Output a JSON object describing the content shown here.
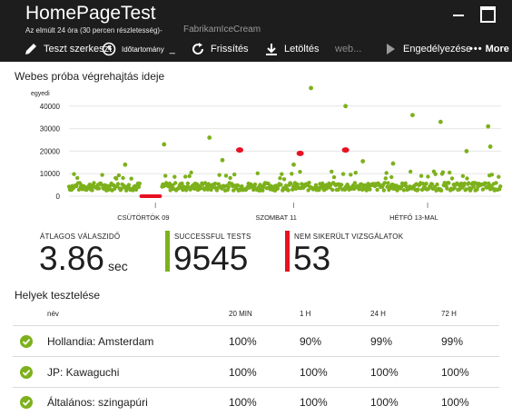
{
  "header": {
    "title": "HomePageTest",
    "subtitle": "Az elmúlt 24 óra (30 percen részletesség)-",
    "resource": "FabrikamIceCream"
  },
  "toolbar": {
    "edit_label": "Teszt szerkeszt",
    "timerange_label": "Időtartomány",
    "timerange_suffix": "_",
    "refresh_label": "Frissítés",
    "download_label": "Letöltés",
    "web_label": "web...",
    "enable_label": "Engedélyezése",
    "more_label": "More"
  },
  "chart": {
    "title": "Webes próba végrehajtás ideje",
    "unit_label": "egyedi"
  },
  "chart_data": {
    "type": "scatter",
    "title": "Webes próba végrehajtás ideje",
    "ylabel": "egyedi",
    "yticks": [
      0,
      10000,
      20000,
      30000,
      40000
    ],
    "ylim": [
      0,
      50000
    ],
    "xticks": [
      "CSÜTÖRTÖK 09",
      "SZOMBAT 11",
      "HÉTFŐ 13-MAL"
    ],
    "series": [
      {
        "color": "#7db11c",
        "outliers": [
          {
            "x": 0.22,
            "y": 23000
          },
          {
            "x": 0.325,
            "y": 26000
          },
          {
            "x": 0.56,
            "y": 48000
          },
          {
            "x": 0.64,
            "y": 40000
          },
          {
            "x": 0.795,
            "y": 36000
          },
          {
            "x": 0.86,
            "y": 33000
          },
          {
            "x": 0.92,
            "y": 20000
          },
          {
            "x": 0.97,
            "y": 31000
          },
          {
            "x": 0.975,
            "y": 22000
          },
          {
            "x": 0.355,
            "y": 16000
          },
          {
            "x": 0.52,
            "y": 14000
          },
          {
            "x": 0.68,
            "y": 15500
          },
          {
            "x": 0.75,
            "y": 14500
          },
          {
            "x": 0.13,
            "y": 14000
          }
        ]
      },
      {
        "color": "#e81123",
        "failures": [
          {
            "x": 0.395,
            "y": 20500
          },
          {
            "x": 0.535,
            "y": 19000
          },
          {
            "x": 0.64,
            "y": 20500
          }
        ]
      }
    ]
  },
  "metrics": {
    "avg_label": "ÁTLAGOS VÁLASZIDŐ",
    "avg_value": "3.86",
    "avg_unit": "sec",
    "success_label": "SUCCESSFUL TESTS",
    "success_value": "9545",
    "success_color": "#7db11c",
    "failed_label": "NEM SIKERÜLT VIZSGÁLATOK",
    "failed_value": "53",
    "failed_color": "#e81123"
  },
  "locations": {
    "title": "Helyek tesztelése",
    "columns": [
      "név",
      "20 MIN",
      "1 H",
      "24 H",
      "72 H"
    ],
    "rows": [
      {
        "name": "Hollandia: Amsterdam",
        "values": [
          "100%",
          "90%",
          "99%",
          "99%"
        ]
      },
      {
        "name": "JP: Kawaguchi",
        "values": [
          "100%",
          "100%",
          "100%",
          "100%"
        ]
      },
      {
        "name": "Általános: szingapúri",
        "values": [
          "100%",
          "100%",
          "100%",
          "100%"
        ]
      }
    ]
  }
}
